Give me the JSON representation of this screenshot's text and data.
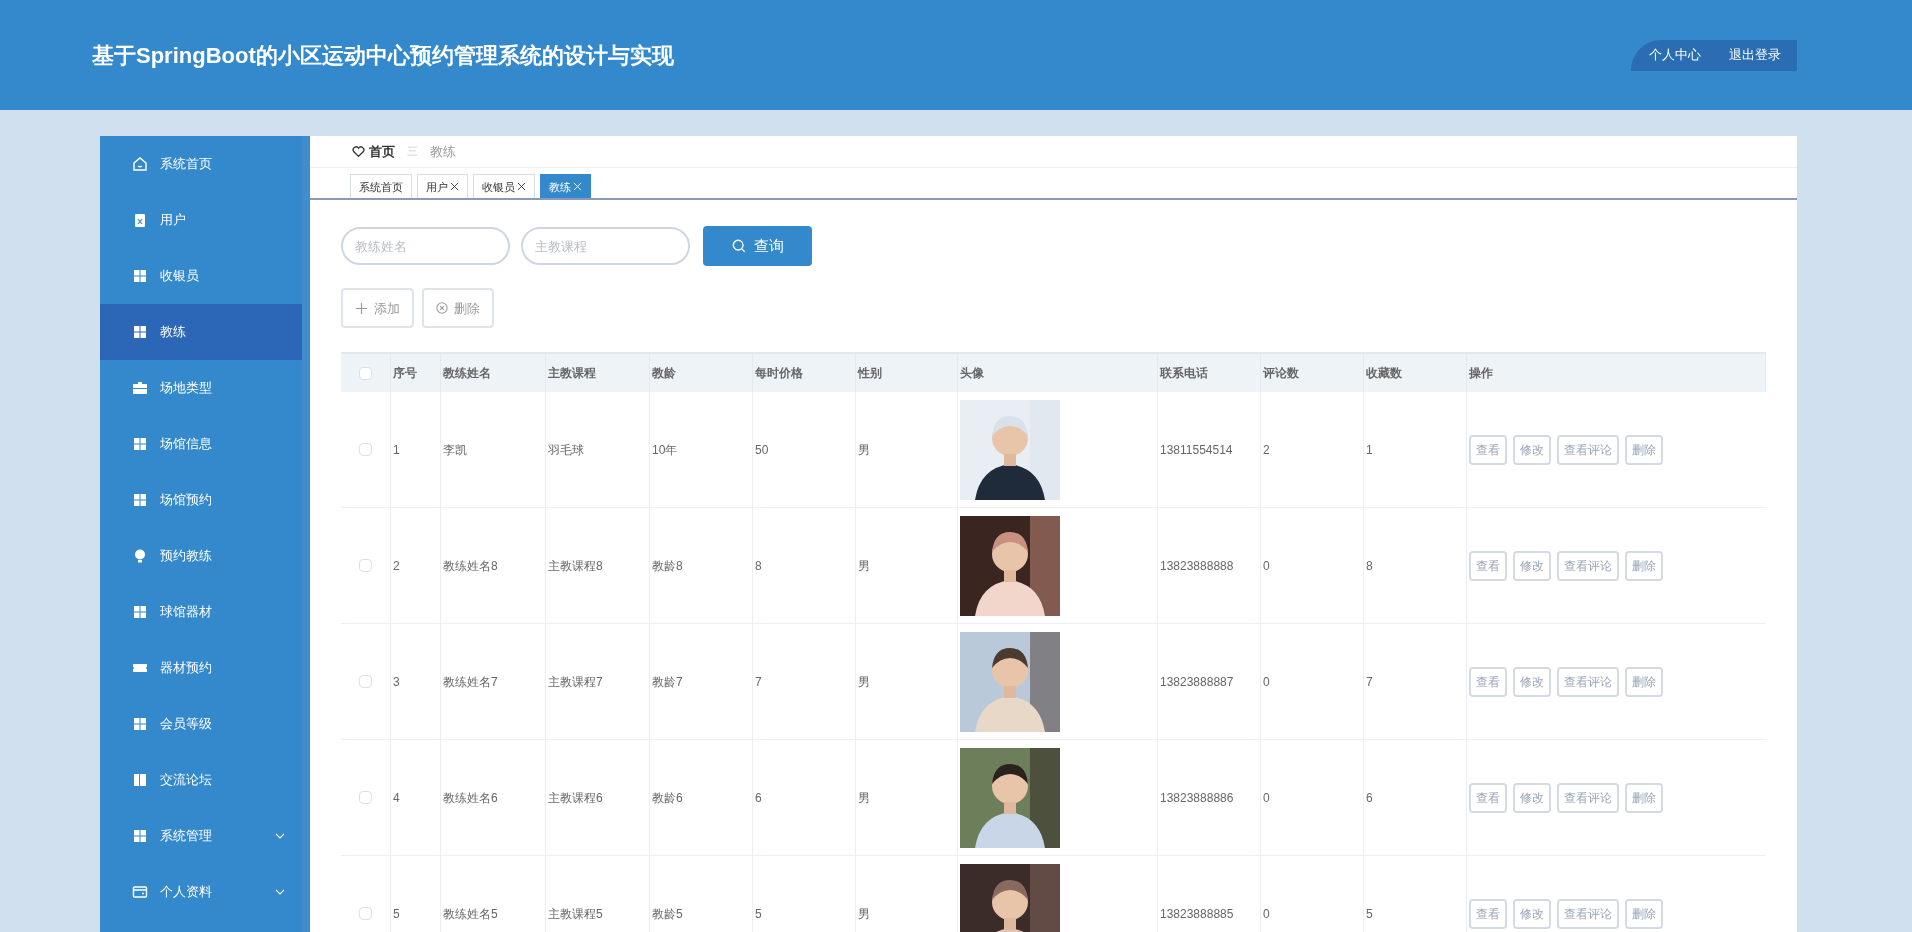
{
  "header": {
    "title": "基于SpringBoot的小区运动中心预约管理系统的设计与实现",
    "links": [
      "个人中心",
      "退出登录"
    ]
  },
  "sidebar": {
    "items": [
      {
        "label": "系统首页",
        "kind": "home",
        "selected": false,
        "expandable": false
      },
      {
        "label": "用户",
        "kind": "clipboard",
        "selected": false,
        "expandable": false
      },
      {
        "label": "收银员",
        "kind": "grid",
        "selected": false,
        "expandable": false
      },
      {
        "label": "教练",
        "kind": "grid",
        "selected": true,
        "expandable": false
      },
      {
        "label": "场地类型",
        "kind": "briefcase",
        "selected": false,
        "expandable": false
      },
      {
        "label": "场馆信息",
        "kind": "grid",
        "selected": false,
        "expandable": false
      },
      {
        "label": "场馆预约",
        "kind": "grid",
        "selected": false,
        "expandable": false
      },
      {
        "label": "预约教练",
        "kind": "bulb",
        "selected": false,
        "expandable": false
      },
      {
        "label": "球馆器材",
        "kind": "grid",
        "selected": false,
        "expandable": false
      },
      {
        "label": "器材预约",
        "kind": "ticket",
        "selected": false,
        "expandable": false
      },
      {
        "label": "会员等级",
        "kind": "grid",
        "selected": false,
        "expandable": false
      },
      {
        "label": "交流论坛",
        "kind": "book",
        "selected": false,
        "expandable": false
      },
      {
        "label": "系统管理",
        "kind": "grid",
        "selected": false,
        "expandable": true
      },
      {
        "label": "个人资料",
        "kind": "card",
        "selected": false,
        "expandable": true
      }
    ]
  },
  "breadcrumb": {
    "home": "首页",
    "separator": "三",
    "current": "教练"
  },
  "tabs": [
    {
      "label": "系统首页",
      "closable": false,
      "selected": false
    },
    {
      "label": "用户",
      "closable": true,
      "selected": false
    },
    {
      "label": "收银员",
      "closable": true,
      "selected": false
    },
    {
      "label": "教练",
      "closable": true,
      "selected": true
    }
  ],
  "search": {
    "fields": [
      {
        "placeholder": "教练姓名"
      },
      {
        "placeholder": "主教课程"
      }
    ],
    "button": "查询"
  },
  "actions": [
    {
      "label": "添加",
      "kind": "add"
    },
    {
      "label": "删除",
      "kind": "delete"
    }
  ],
  "table": {
    "select_all_checked": false,
    "columns": [
      "序号",
      "教练姓名",
      "主教课程",
      "教龄",
      "每时价格",
      "性别",
      "头像",
      "联系电话",
      "评论数",
      "收藏数",
      "操作"
    ],
    "rows": [
      {
        "checked": false,
        "cells": [
          "1",
          "李凯",
          "羽毛球",
          "10年",
          "50",
          "男",
          null,
          "13811554514",
          "2",
          "1"
        ],
        "actions": [
          "查看",
          "修改",
          "查看评论",
          "删除"
        ]
      },
      {
        "checked": false,
        "cells": [
          "2",
          "教练姓名8",
          "主教课程8",
          "教龄8",
          "8",
          "男",
          null,
          "13823888888",
          "0",
          "8"
        ],
        "actions": [
          "查看",
          "修改",
          "查看评论",
          "删除"
        ]
      },
      {
        "checked": false,
        "cells": [
          "3",
          "教练姓名7",
          "主教课程7",
          "教龄7",
          "7",
          "男",
          null,
          "13823888887",
          "0",
          "7"
        ],
        "actions": [
          "查看",
          "修改",
          "查看评论",
          "删除"
        ]
      },
      {
        "checked": false,
        "cells": [
          "4",
          "教练姓名6",
          "主教课程6",
          "教龄6",
          "6",
          "男",
          null,
          "13823888886",
          "0",
          "6"
        ],
        "actions": [
          "查看",
          "修改",
          "查看评论",
          "删除"
        ]
      },
      {
        "checked": false,
        "cells": [
          "5",
          "教练姓名5",
          "主教课程5",
          "教龄5",
          "5",
          "男",
          null,
          "13823888885",
          "0",
          "5"
        ],
        "actions": [
          "查看",
          "修改",
          "查看评论",
          "删除"
        ]
      }
    ]
  }
}
